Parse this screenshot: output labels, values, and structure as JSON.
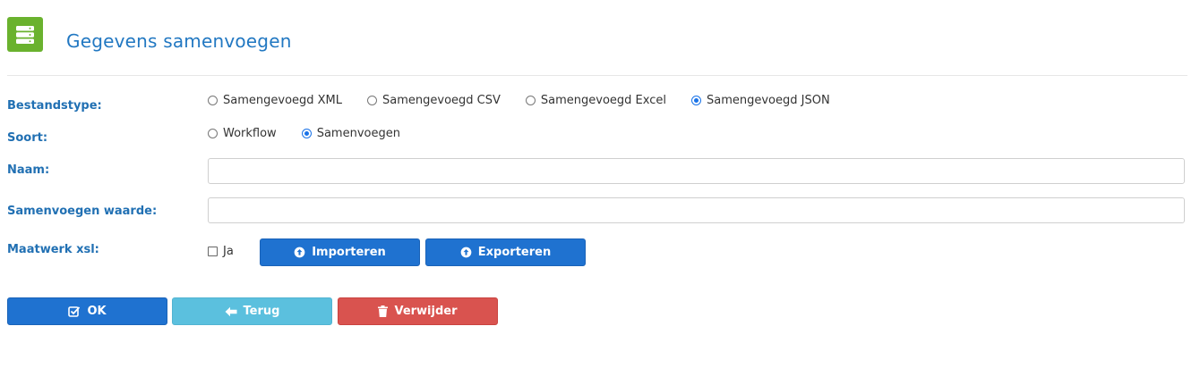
{
  "header": {
    "title": "Gegevens samenvoegen",
    "icon": "server-stack-icon",
    "icon_color": "#6ab22e"
  },
  "form": {
    "bestandstype": {
      "label": "Bestandstype:",
      "options": [
        {
          "label": "Samengevoegd XML",
          "checked": false
        },
        {
          "label": "Samengevoegd CSV",
          "checked": false
        },
        {
          "label": "Samengevoegd Excel",
          "checked": false
        },
        {
          "label": "Samengevoegd JSON",
          "checked": true
        }
      ]
    },
    "soort": {
      "label": "Soort:",
      "options": [
        {
          "label": "Workflow",
          "checked": false
        },
        {
          "label": "Samenvoegen",
          "checked": true
        }
      ]
    },
    "naam": {
      "label": "Naam:",
      "value": ""
    },
    "samenvoegen_waarde": {
      "label": "Samenvoegen waarde:",
      "value": ""
    },
    "maatwerk": {
      "label": "Maatwerk xsl:",
      "checkbox_label": "Ja",
      "checked": false,
      "import_label": "Importeren",
      "export_label": "Exporteren"
    }
  },
  "actions": {
    "ok_label": "OK",
    "back_label": "Terug",
    "delete_label": "Verwijder"
  },
  "colors": {
    "accent": "#2278c2",
    "primary_button": "#1f72d0",
    "info_button": "#5bc0de",
    "danger_button": "#d9534f"
  }
}
